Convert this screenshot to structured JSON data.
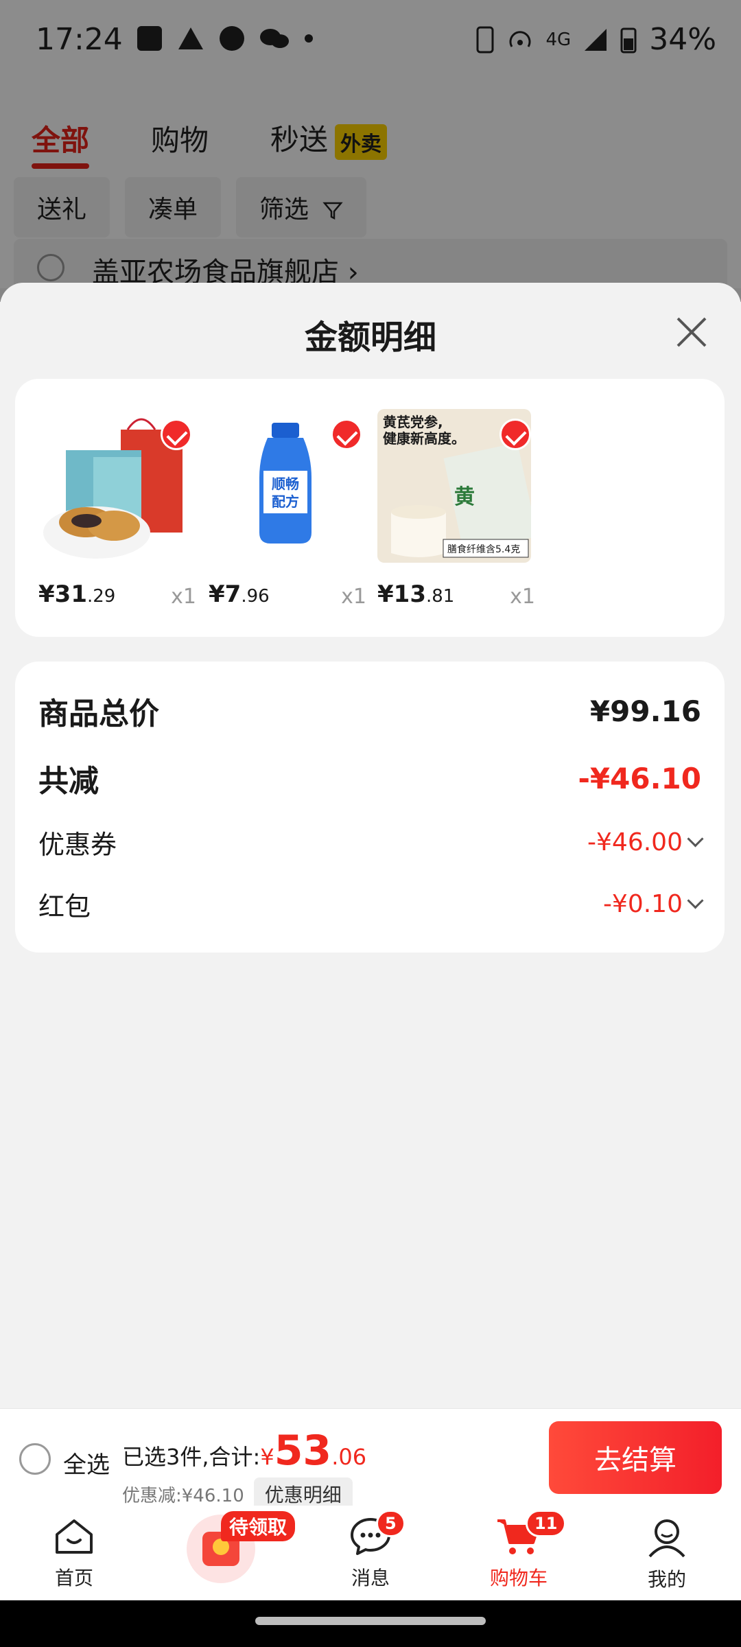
{
  "status_bar": {
    "time": "17:24",
    "battery": "34%",
    "network": "4G"
  },
  "background": {
    "tabs": [
      "全部",
      "购物",
      "秒送"
    ],
    "waimai_badge": "外卖",
    "filters": [
      "送礼",
      "凑单",
      "筛选"
    ],
    "store_name": "盖亚农场食品旗舰店 ›"
  },
  "sheet": {
    "title": "金额明细",
    "products": [
      {
        "price_int": "¥31",
        "price_cents": ".29",
        "qty": "x1"
      },
      {
        "price_int": "¥7",
        "price_cents": ".96",
        "qty": "x1"
      },
      {
        "price_int": "¥13",
        "price_cents": ".81",
        "qty": "x1"
      }
    ],
    "product3_headline": "黄芪党参,\n健康新高度。",
    "product3_tag": "膳食纤维含5.4克",
    "product2_text": "顺畅\n配方",
    "summary": {
      "total_label": "商品总价",
      "total_value": "¥99.16",
      "reduce_label": "共减",
      "reduce_value": "-¥46.10",
      "coupon_label": "优惠券",
      "coupon_value": "-¥46.00",
      "redpacket_label": "红包",
      "redpacket_value": "-¥0.10"
    }
  },
  "checkout": {
    "select_all": "全选",
    "summary_prefix": "已选3件,合计:",
    "yen": "¥",
    "total_int": "53",
    "total_cents": ".06",
    "discount_text": "优惠减:¥46.10",
    "detail_button": "优惠明细",
    "checkout_button": "去结算"
  },
  "tabbar": {
    "items": [
      {
        "label": "首页"
      },
      {
        "label": ""
      },
      {
        "label": "消息",
        "badge": "5"
      },
      {
        "label": "购物车",
        "badge": "11"
      },
      {
        "label": "我的"
      }
    ],
    "coupon_badge": "待领取"
  },
  "colors": {
    "accent": "#f0281e",
    "waimai": "#ffd400"
  }
}
